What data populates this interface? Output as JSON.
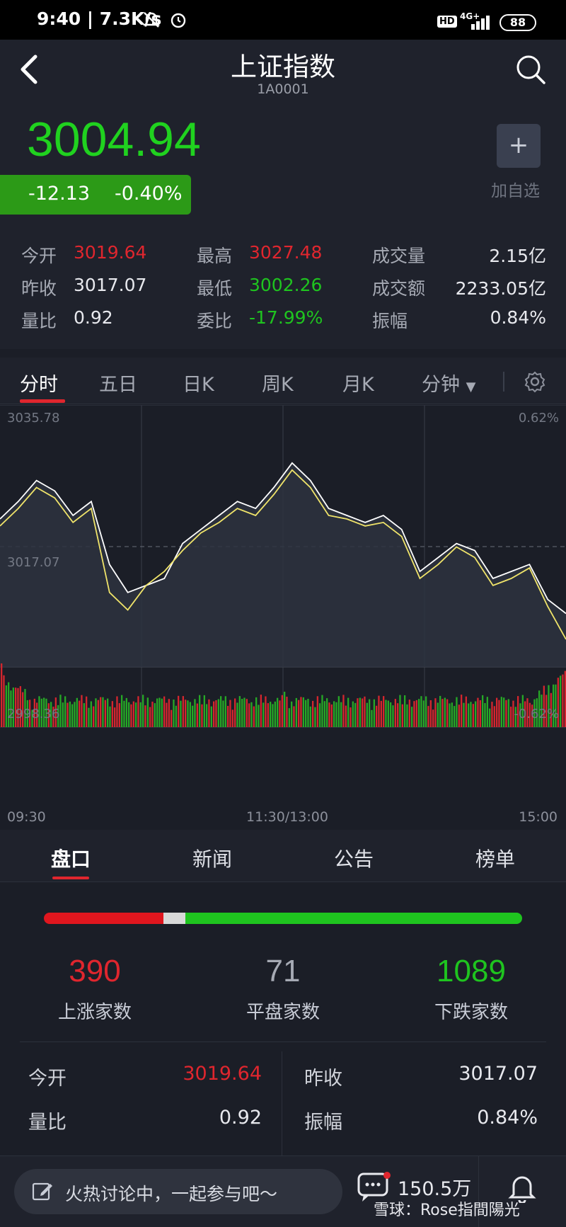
{
  "status_bar": {
    "time": "9:40",
    "speed": "7.3K/s",
    "hd": "HD",
    "network": "4G+",
    "battery": "88"
  },
  "header": {
    "title": "上证指数",
    "code": "1A0001"
  },
  "quote": {
    "price": "3004.94",
    "change": "-12.13",
    "change_pct": "-0.40%",
    "add_label": "加自选",
    "add_symbol": "+"
  },
  "stats": [
    {
      "label": "今开",
      "value": "3019.64",
      "color": "red"
    },
    {
      "label": "最高",
      "value": "3027.48",
      "color": "red"
    },
    {
      "label": "成交量",
      "value": "2.15亿",
      "color": "white"
    },
    {
      "label": "昨收",
      "value": "3017.07",
      "color": "white"
    },
    {
      "label": "最低",
      "value": "3002.26",
      "color": "green"
    },
    {
      "label": "成交额",
      "value": "2233.05亿",
      "color": "white"
    },
    {
      "label": "量比",
      "value": "0.92",
      "color": "white"
    },
    {
      "label": "委比",
      "value": "-17.99%",
      "color": "green"
    },
    {
      "label": "振幅",
      "value": "0.84%",
      "color": "white"
    }
  ],
  "chart_tabs": [
    "分时",
    "五日",
    "日K",
    "周K",
    "月K",
    "分钟"
  ],
  "chart": {
    "y_max_label": "3035.78",
    "y_mid_label": "3017.07",
    "y_min_label": "2998.36",
    "pct_max_label": "0.62%",
    "pct_min_label": "-0.62%",
    "x_labels": [
      "09:30",
      "11:30/13:00",
      "15:00"
    ]
  },
  "chart_data": {
    "type": "line",
    "ylim": [
      2998.36,
      3035.78
    ],
    "reference": 3017.07,
    "series": [
      {
        "color": "#ffffff",
        "values": [
          3019.5,
          3022,
          3025,
          3023.5,
          3020,
          3022,
          3013,
          3009,
          3010,
          3011,
          3016,
          3018,
          3020,
          3022,
          3021,
          3024,
          3027.5,
          3025,
          3021,
          3020,
          3019,
          3020,
          3018,
          3012,
          3014,
          3016,
          3015,
          3011,
          3012,
          3013,
          3008,
          3006
        ]
      },
      {
        "color": "#f0e46a",
        "values": [
          3018.5,
          3021,
          3024,
          3022.5,
          3019,
          3021,
          3009,
          3006.5,
          3010,
          3012,
          3015,
          3017.5,
          3019,
          3021,
          3020,
          3023,
          3026.5,
          3024,
          3020,
          3019.5,
          3018.5,
          3019,
          3017,
          3011,
          3013,
          3015.5,
          3014,
          3010,
          3011,
          3012.5,
          3007,
          3002.3
        ]
      }
    ]
  },
  "bottom_tabs": [
    "盘口",
    "新闻",
    "公告",
    "榜单"
  ],
  "breadth": {
    "up": "390",
    "up_label": "上涨家数",
    "flat": "71",
    "flat_label": "平盘家数",
    "down": "1089",
    "down_label": "下跌家数"
  },
  "bottom_stats": [
    {
      "label": "今开",
      "value": "3019.64",
      "color": "red"
    },
    {
      "label": "昨收",
      "value": "3017.07",
      "color": "white"
    },
    {
      "label": "量比",
      "value": "0.92",
      "color": "white"
    },
    {
      "label": "振幅",
      "value": "0.84%",
      "color": "white"
    }
  ],
  "bottom_bar": {
    "comment_placeholder": "火热讨论中，一起参与吧～",
    "comment_count": "150.5万",
    "watermark": "雪球：Rose指間陽光"
  },
  "colors": {
    "up": "#e0262e",
    "down": "#1fc41f",
    "background": "#1b1e27"
  }
}
